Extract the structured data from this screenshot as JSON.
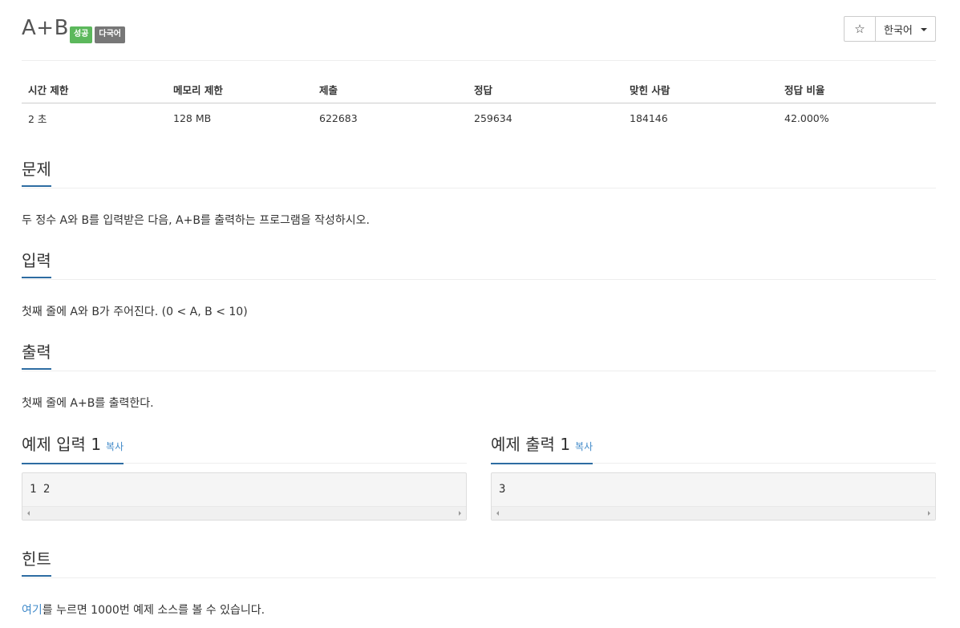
{
  "problem": {
    "title": "A+B",
    "badges": [
      "성공",
      "다국어"
    ]
  },
  "controls": {
    "star_icon": "☆",
    "language": "한국어"
  },
  "info_table": {
    "headers": [
      "시간 제한",
      "메모리 제한",
      "제출",
      "정답",
      "맞힌 사람",
      "정답 비율"
    ],
    "values": [
      "2 초",
      "128 MB",
      "622683",
      "259634",
      "184146",
      "42.000%"
    ]
  },
  "sections": {
    "description": {
      "title": "문제",
      "text": "두 정수 A와 B를 입력받은 다음, A+B를 출력하는 프로그램을 작성하시오."
    },
    "input": {
      "title": "입력",
      "text": "첫째 줄에 A와 B가 주어진다. (0 < A, B < 10)"
    },
    "output": {
      "title": "출력",
      "text": "첫째 줄에 A+B를 출력한다."
    }
  },
  "samples": {
    "input": {
      "title": "예제 입력 1",
      "copy_label": "복사",
      "content": "1 2"
    },
    "output": {
      "title": "예제 출력 1",
      "copy_label": "복사",
      "content": "3"
    }
  },
  "hint": {
    "title": "힌트",
    "link_text": "여기",
    "text_rest": "를 누르면 1000번 예제 소스를 볼 수 있습니다."
  },
  "colors": {
    "accent": "#2d6ca2",
    "success_badge": "#5cb85c",
    "multilang_badge": "#777777",
    "link": "#428bca"
  }
}
